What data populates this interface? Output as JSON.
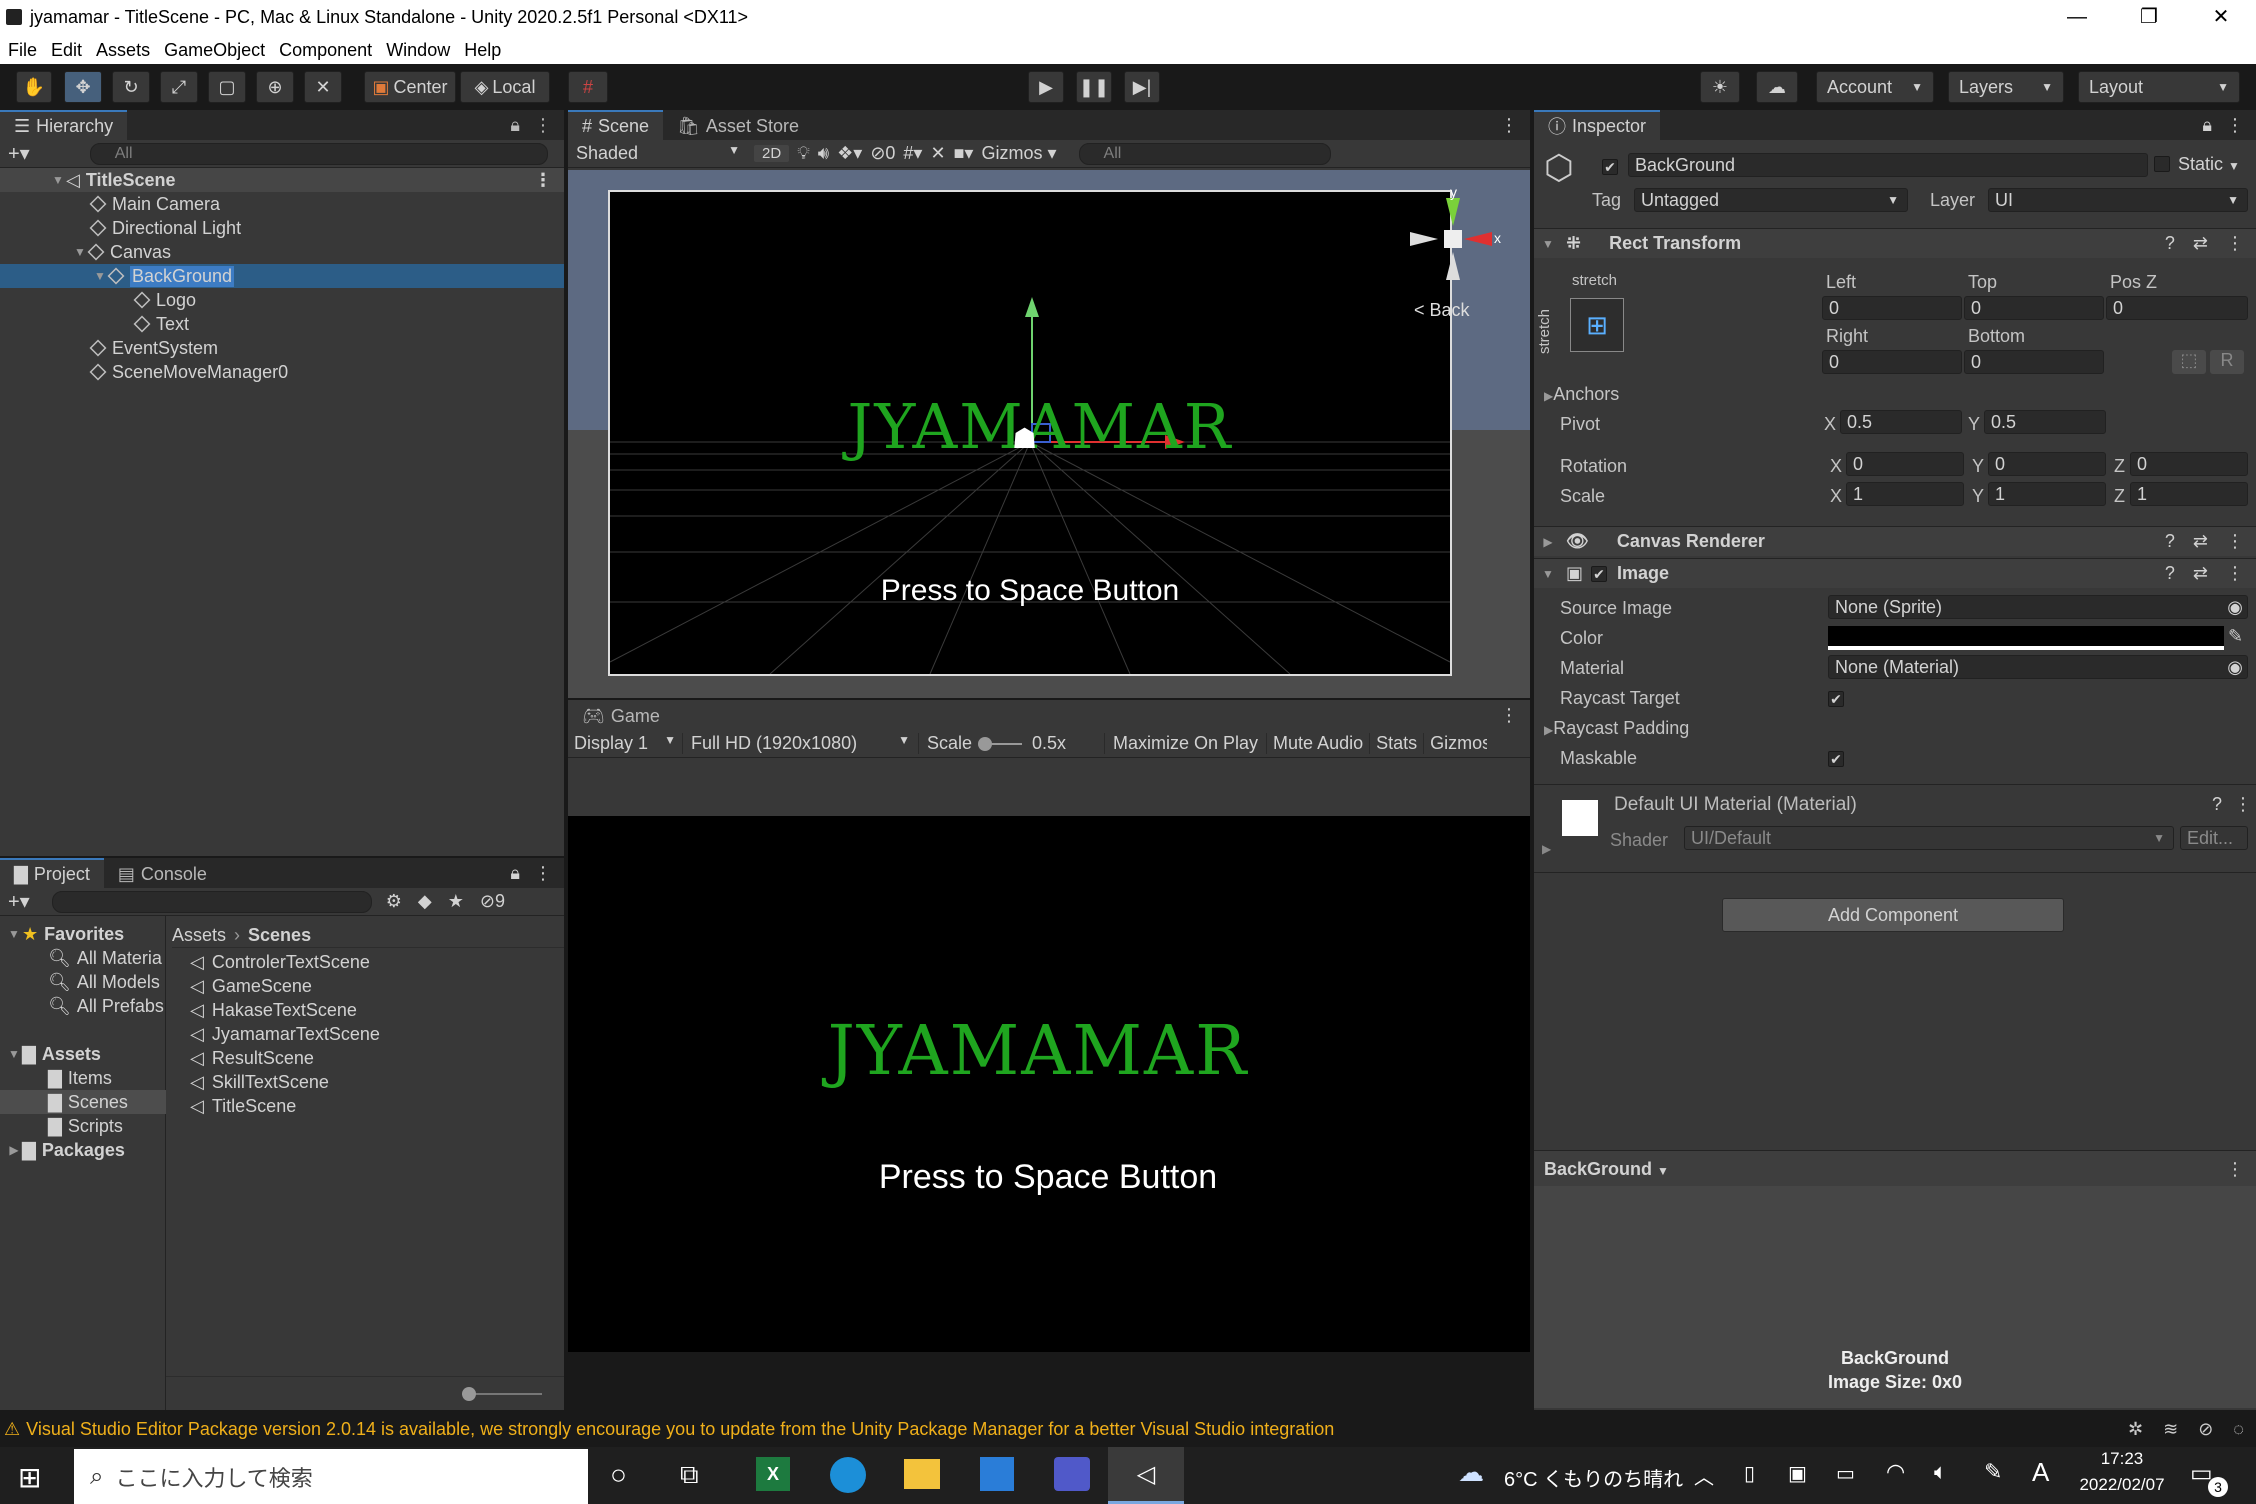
{
  "window": {
    "title": "jyamamar - TitleScene - PC, Mac & Linux Standalone - Unity 2020.2.5f1 Personal <DX11>",
    "min": "—",
    "restore": "❐",
    "close": "✕"
  },
  "menu": [
    "File",
    "Edit",
    "Assets",
    "GameObject",
    "Component",
    "Window",
    "Help"
  ],
  "toolbar": {
    "center": "Center",
    "local": "Local",
    "account": "Account",
    "layers": "Layers",
    "layout": "Layout"
  },
  "hierarchy": {
    "tab": "Hierarchy",
    "search_placeholder": "All",
    "scene": "TitleScene",
    "items": [
      "Main Camera",
      "Directional Light",
      "Canvas",
      "BackGround",
      "Logo",
      "Text",
      "EventSystem",
      "SceneMoveManager0"
    ]
  },
  "scene": {
    "tab": "Scene",
    "tab2": "Asset Store",
    "shading": "Shaded",
    "mode2d": "2D",
    "hidden_count": "0",
    "gizmos": "Gizmos",
    "search_placeholder": "All",
    "logo_text": "JYAMAMAR",
    "press_text": "Press to Space Button",
    "back_label": "< Back",
    "axis_y": "y",
    "axis_x": "x"
  },
  "game": {
    "tab": "Game",
    "display": "Display 1",
    "resolution": "Full HD (1920x1080)",
    "scale_label": "Scale",
    "scale_value": "0.5x",
    "maximize": "Maximize On Play",
    "mute": "Mute Audio",
    "stats": "Stats",
    "gizmos": "Gizmos",
    "logo_text": "JYAMAMAR",
    "press_text": "Press to Space Button"
  },
  "project": {
    "tab": "Project",
    "tab2": "Console",
    "hidden_count": "9",
    "favorites_label": "Favorites",
    "favorites": [
      "All Materia",
      "All Models",
      "All Prefabs"
    ],
    "assets_label": "Assets",
    "asset_folders": [
      "Items",
      "Scenes",
      "Scripts"
    ],
    "packages_label": "Packages",
    "breadcrumb_root": "Assets",
    "breadcrumb_current": "Scenes",
    "files": [
      "ControlerTextScene",
      "GameScene",
      "HakaseTextScene",
      "JyamamarTextScene",
      "ResultScene",
      "SkillTextScene",
      "TitleScene"
    ]
  },
  "inspector": {
    "tab": "Inspector",
    "object_name": "BackGround",
    "static_label": "Static",
    "tag_label": "Tag",
    "tag_value": "Untagged",
    "layer_label": "Layer",
    "layer_value": "UI",
    "rect": {
      "title": "Rect Transform",
      "stretch_top": "stretch",
      "stretch_side": "stretch",
      "left_label": "Left",
      "top_label": "Top",
      "posz_label": "Pos Z",
      "left": "0",
      "top": "0",
      "posz": "0",
      "right_label": "Right",
      "bottom_label": "Bottom",
      "right": "0",
      "bottom": "0",
      "r_btn": "R",
      "anchors": "Anchors",
      "pivot": "Pivot",
      "pivot_x": "0.5",
      "pivot_y": "0.5",
      "rotation": "Rotation",
      "rot_x": "0",
      "rot_y": "0",
      "rot_z": "0",
      "scale": "Scale",
      "scale_x": "1",
      "scale_y": "1",
      "scale_z": "1",
      "x": "X",
      "y": "Y",
      "z": "Z"
    },
    "canvas_renderer": "Canvas Renderer",
    "image": {
      "title": "Image",
      "source_label": "Source Image",
      "source_value": "None (Sprite)",
      "color_label": "Color",
      "material_label": "Material",
      "material_value": "None (Material)",
      "raycast_label": "Raycast Target",
      "padding_label": "Raycast Padding",
      "maskable_label": "Maskable"
    },
    "material": {
      "name": "Default UI Material (Material)",
      "shader_label": "Shader",
      "shader_value": "UI/Default",
      "edit": "Edit..."
    },
    "add_component": "Add Component",
    "preview_title": "BackGround",
    "preview_name": "BackGround",
    "preview_size": "Image Size: 0x0"
  },
  "status": {
    "message": "Visual Studio Editor Package version 2.0.14 is available, we strongly encourage you to update from the Unity Package Manager for a better Visual Studio integration"
  },
  "taskbar": {
    "search_placeholder": "ここに入力して検索",
    "weather": "6°C くもりのち晴れ",
    "time": "17:23",
    "date": "2022/02/07",
    "ime": "A",
    "notif": "3"
  },
  "colors": {
    "selection": "#2c5d87",
    "accent": "#3a79bb",
    "logo_green": "#1fa51f",
    "warning": "#f0b01a"
  }
}
